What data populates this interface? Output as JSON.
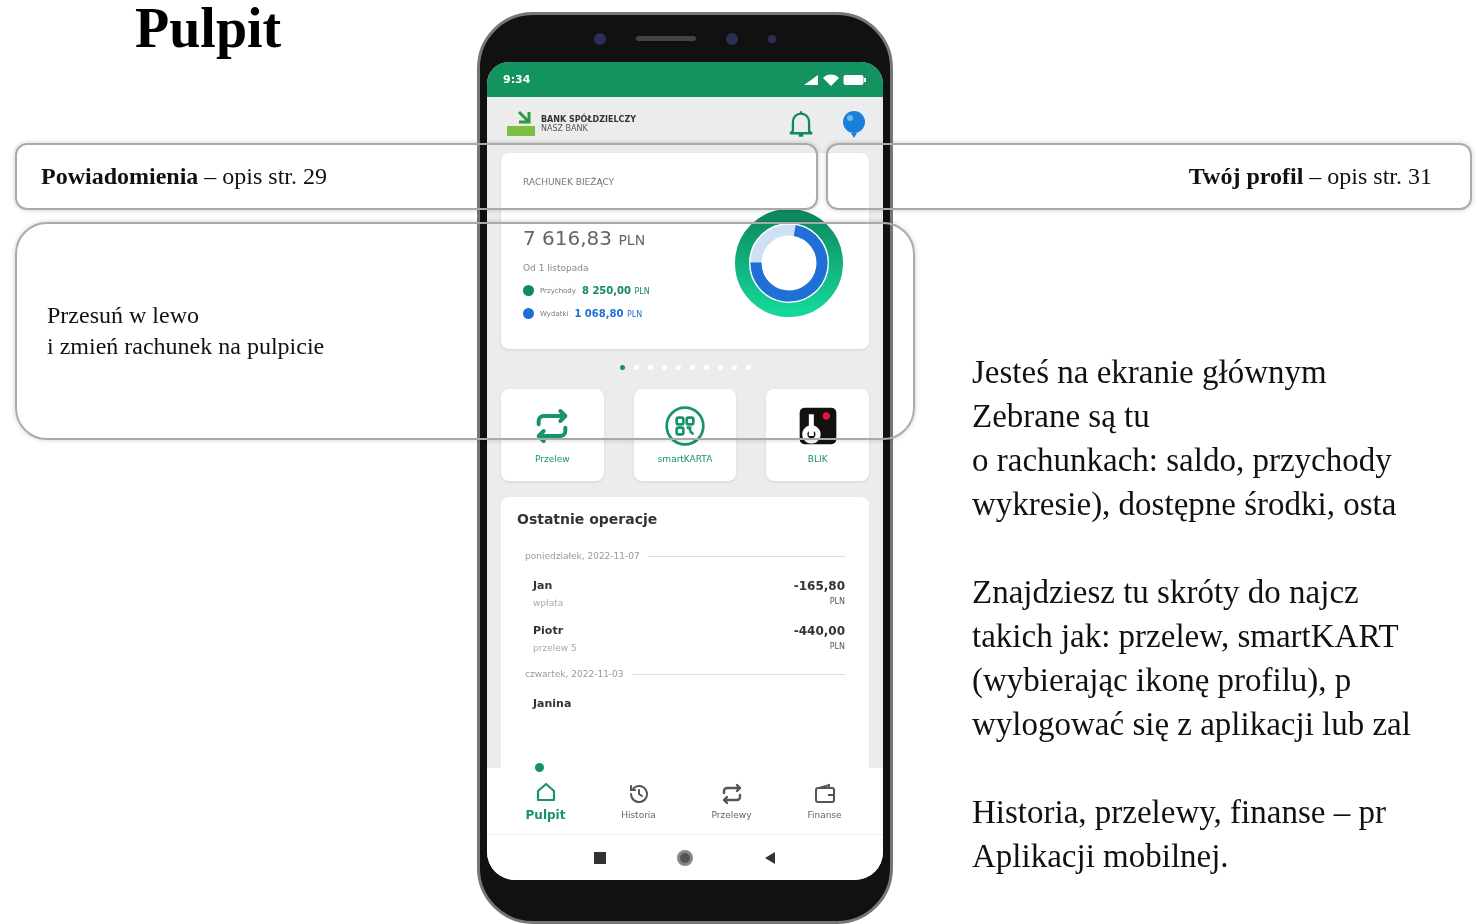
{
  "heading": "Pulpit",
  "phone": {
    "status_bar": {
      "time": "9:34"
    },
    "bank": {
      "name": "BANK SPÓŁDZIELCZY",
      "subtitle": "NASZ BANK"
    },
    "account": {
      "name": "RACHUNEK BIEŻĄCY",
      "balance": "7 616,83",
      "currency": "PLN",
      "period": "Od 1 listopada",
      "legend": [
        {
          "label": "Przychody",
          "amount": "8 250,00",
          "currency": "PLN",
          "color": "#0f8a5f"
        },
        {
          "label": "Wydatki",
          "amount": "1 068,80",
          "currency": "PLN",
          "color": "#1f6fd6"
        }
      ]
    },
    "pager_dots": [
      {
        "selected": true
      },
      {
        "selected": false
      },
      {
        "selected": false
      },
      {
        "selected": false
      },
      {
        "selected": false
      },
      {
        "selected": false
      },
      {
        "selected": false
      },
      {
        "selected": false
      },
      {
        "selected": false
      },
      {
        "selected": false
      }
    ],
    "shortcuts": [
      {
        "label": "Przelew",
        "kind": "transfer"
      },
      {
        "label": "smartKARTA",
        "kind": "qr"
      },
      {
        "label": "BLIK",
        "kind": "blik"
      }
    ],
    "recent": {
      "title": "Ostatnie operacje",
      "groups": [
        {
          "date": "poniedziałek, 2022-11-07",
          "items": [
            {
              "name": "Jan",
              "description": "wpłata",
              "amount": "-165,80",
              "currency": "PLN"
            },
            {
              "name": "Piotr",
              "description": "przelew 5",
              "amount": "-440,00",
              "currency": "PLN"
            }
          ]
        },
        {
          "date": "czwartek, 2022-11-03",
          "items": [
            {
              "name": "Janina"
            }
          ]
        }
      ]
    },
    "nav": [
      {
        "label": "Pulpit",
        "kind": "home",
        "selected": true
      },
      {
        "label": "Historia",
        "kind": "history",
        "selected": false
      },
      {
        "label": "Przelewy",
        "kind": "transfer",
        "selected": false
      },
      {
        "label": "Finanse",
        "kind": "wallet",
        "selected": false
      }
    ]
  },
  "callouts": [
    {
      "kind": "notifications",
      "text": "**Powiadomienia** – opis str. 29"
    },
    {
      "kind": "profile",
      "text": "**Twój profil** – opis str. 31"
    },
    {
      "kind": "swipe",
      "lines": [
        "Przesuń w lewo",
        "i zmień rachunek na pulpicie"
      ]
    }
  ],
  "body_paragraphs": [
    [
      "Jesteś na ekranie głównym",
      "Zebrane są tu",
      "o rachunkach: saldo, przychody",
      "wykresie), dostępne środki, osta"
    ],
    [
      "Znajdziesz tu skróty do najcz",
      "takich jak: przelew, smartKART",
      "(wybierając ikonę profilu), p",
      "wylogować się z aplikacji lub zal"
    ],
    [
      "Historia, przelewy, finanse – pr",
      "Aplikacji mobilnej."
    ]
  ]
}
